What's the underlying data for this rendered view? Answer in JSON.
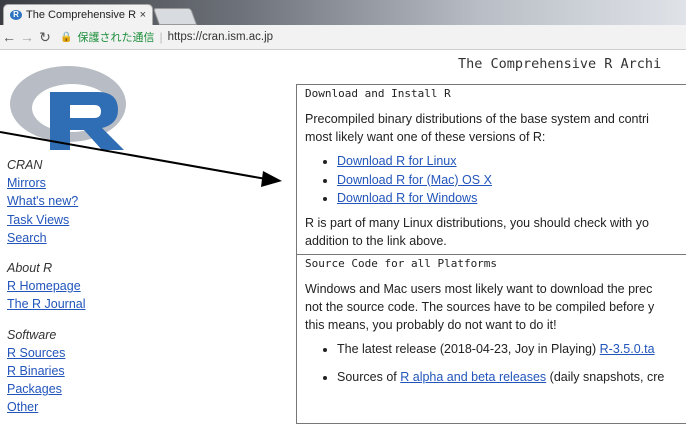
{
  "browser": {
    "tab_title": "The Comprehensive R",
    "tab_favicon_letter": "R",
    "tab_close": "×",
    "secure_label": "保護された通信",
    "url": "https://cran.ism.ac.jp"
  },
  "page": {
    "banner": "The Comprehensive R Archi",
    "logo_letter": "R",
    "sidebar": [
      {
        "heading": "CRAN",
        "links": [
          "Mirrors",
          "What's new?",
          "Task Views",
          "Search"
        ]
      },
      {
        "heading": "About R",
        "links": [
          "R Homepage",
          "The R Journal"
        ]
      },
      {
        "heading": "Software",
        "links": [
          "R Sources",
          "R Binaries",
          "Packages",
          "Other"
        ]
      }
    ],
    "download": {
      "heading": "Download and Install R",
      "intro_line1": "Precompiled binary distributions of the base system and contri",
      "intro_line2": "most likely want one of these versions of R:",
      "links": [
        "Download R for Linux",
        "Download R for (Mac) OS X",
        "Download R for Windows"
      ],
      "after_line1": "R is part of many Linux distributions, you should check with yo",
      "after_line2": "addition to the link above."
    },
    "source": {
      "heading": "Source Code for all Platforms",
      "line1": "Windows and Mac users most likely want to download the prec",
      "line2": "not the source code. The sources have to be compiled before y",
      "line3": "this means, you probably do not want to do it!",
      "bullet1_text": "The latest release (2018-04-23, Joy in Playing)",
      "bullet1_link": "R-3.5.0.ta",
      "bullet2_prefix": "Sources of",
      "bullet2_link": "R alpha and beta releases",
      "bullet2_suffix": "(daily snapshots, cre"
    }
  },
  "colors": {
    "link": "#2255bb",
    "secure": "#1e8f3c",
    "logo_blue": "#2f6db4",
    "logo_grey": "#b8bcc4"
  }
}
